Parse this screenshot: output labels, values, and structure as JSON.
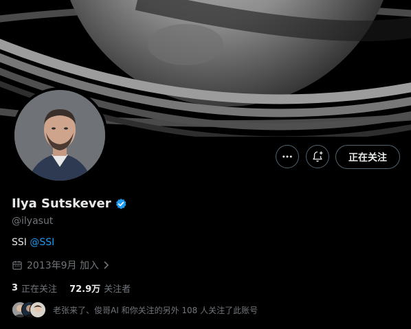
{
  "profile": {
    "name": "Ilya Sutskever",
    "handle": "@ilyasut",
    "bio_text": "SSI ",
    "bio_mention": "@SSI",
    "joined": "2013年9月 加入",
    "verified": true
  },
  "actions": {
    "more_icon": "more-horizontal-icon",
    "notify_icon": "notification-bell-add-icon",
    "follow_label": "正在关注"
  },
  "stats": {
    "following_count": "3",
    "following_label": "正在关注",
    "followers_count": "72.9万",
    "followers_label": "关注者"
  },
  "followed_by": {
    "text": "老张来了、俊哥AI 和你关注的另外 108 人关注了此账号"
  },
  "colors": {
    "background": "#000000",
    "text": "#e7e9ea",
    "secondary_text": "#71767b",
    "accent": "#1d9bf0",
    "border": "#536471"
  }
}
